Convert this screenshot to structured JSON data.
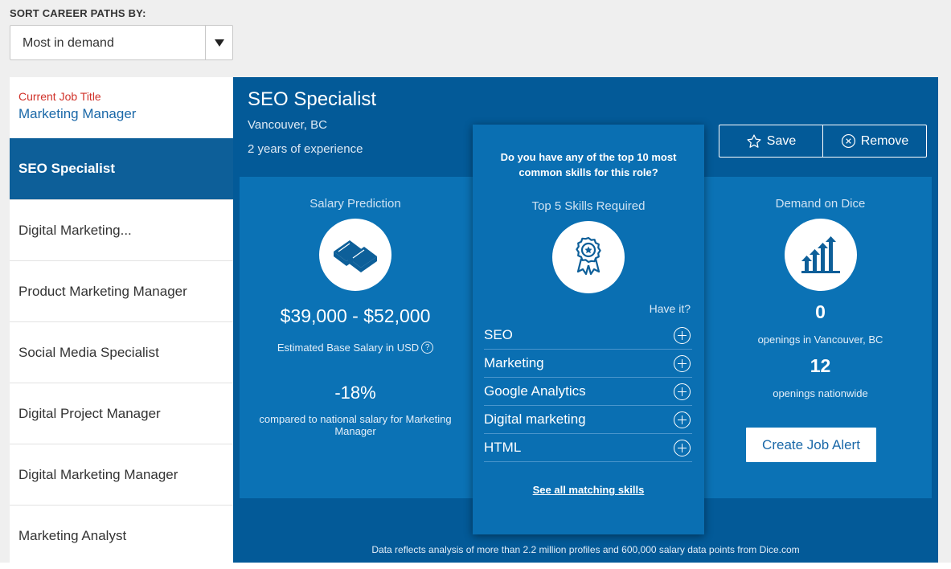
{
  "sort": {
    "label": "SORT CAREER PATHS BY:",
    "selected": "Most in demand"
  },
  "sidebar": {
    "current_label": "Current Job Title",
    "current_title": "Marketing Manager",
    "items": [
      {
        "label": "SEO Specialist"
      },
      {
        "label": "Digital Marketing..."
      },
      {
        "label": "Product Marketing Manager"
      },
      {
        "label": "Social Media Specialist"
      },
      {
        "label": "Digital Project Manager"
      },
      {
        "label": "Digital Marketing Manager"
      },
      {
        "label": "Marketing Analyst"
      }
    ]
  },
  "job": {
    "title": "SEO Specialist",
    "location": "Vancouver, BC",
    "experience": "2 years of experience",
    "save_label": "Save",
    "remove_label": "Remove"
  },
  "salary": {
    "heading": "Salary Prediction",
    "range": "$39,000 - $52,000",
    "sub": "Estimated Base Salary in USD",
    "help": "?",
    "pct": "-18%",
    "pct_sub": "compared to national salary for Marketing Manager"
  },
  "skills": {
    "question": "Do you have any of the top 10 most common skills for this role?",
    "heading": "Top 5 Skills Required",
    "have_label": "Have it?",
    "items": [
      "SEO",
      "Marketing",
      "Google Analytics",
      "Digital marketing",
      "HTML"
    ],
    "see_all": "See all matching skills"
  },
  "demand": {
    "heading": "Demand on Dice",
    "local_count": "0",
    "local_label": "openings in Vancouver, BC",
    "national_count": "12",
    "national_label": "openings nationwide",
    "alert_label": "Create Job Alert"
  },
  "footnote": "Data reflects analysis of more than 2.2 million profiles and 600,000 salary data points from Dice.com",
  "colors": {
    "primary": "#035a98",
    "panel": "#0b72b5",
    "accent_red": "#d0322a",
    "link_blue": "#1a68a8"
  }
}
